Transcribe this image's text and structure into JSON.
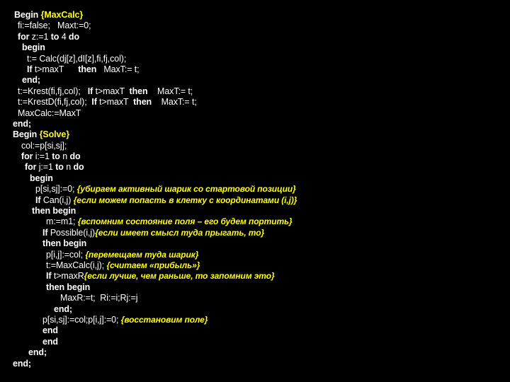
{
  "slide": {
    "background_color": "#000000",
    "code_color": "#FFFFFF",
    "comment_color": "#FFFF00",
    "lines": [
      {
        "indent": 20,
        "parts": [
          {
            "t": "Begin ",
            "s": "kw"
          },
          {
            "t": "{MaxCalc}",
            "s": "cmt-plain"
          }
        ]
      },
      {
        "indent": 25,
        "parts": [
          {
            "t": "fi:=false;   Maxt:=0;",
            "s": "txt"
          }
        ]
      },
      {
        "indent": 25,
        "parts": [
          {
            "t": "for ",
            "s": "kw"
          },
          {
            "t": "z:=1 ",
            "s": "txt"
          },
          {
            "t": "to ",
            "s": "kw"
          },
          {
            "t": "4 ",
            "s": "txt"
          },
          {
            "t": "do",
            "s": "kw"
          }
        ]
      },
      {
        "indent": 31,
        "parts": [
          {
            "t": "begin",
            "s": "kw"
          }
        ]
      },
      {
        "indent": 38,
        "parts": [
          {
            "t": "t:= Calc(dj[z],dI[z],fi,fj,col);",
            "s": "txt"
          }
        ]
      },
      {
        "indent": 38,
        "parts": [
          {
            "t": "If ",
            "s": "kw"
          },
          {
            "t": "t>maxT      ",
            "s": "txt"
          },
          {
            "t": "then ",
            "s": "kw"
          },
          {
            "t": "  MaxT:= t;",
            "s": "txt"
          }
        ]
      },
      {
        "indent": 31,
        "parts": [
          {
            "t": "end;",
            "s": "kw"
          }
        ]
      },
      {
        "indent": 25,
        "parts": [
          {
            "t": "t:=Krest(fi,fj,col);   ",
            "s": "txt"
          },
          {
            "t": "If ",
            "s": "kw"
          },
          {
            "t": "t>maxT  ",
            "s": "txt"
          },
          {
            "t": "then ",
            "s": "kw"
          },
          {
            "t": "   MaxT:= t;",
            "s": "txt"
          }
        ]
      },
      {
        "indent": 25,
        "parts": [
          {
            "t": "t:=KrestD(fi,fj,col);  ",
            "s": "txt"
          },
          {
            "t": "If ",
            "s": "kw"
          },
          {
            "t": "t>maxT  ",
            "s": "txt"
          },
          {
            "t": "then ",
            "s": "kw"
          },
          {
            "t": "   MaxT:= t;",
            "s": "txt"
          }
        ]
      },
      {
        "indent": 25,
        "parts": [
          {
            "t": "MaxCalc:=MaxT",
            "s": "txt"
          }
        ]
      },
      {
        "indent": 18,
        "parts": [
          {
            "t": "end;",
            "s": "kw"
          }
        ]
      },
      {
        "indent": 18,
        "parts": [
          {
            "t": "Begin ",
            "s": "kw"
          },
          {
            "t": "{Solve}",
            "s": "cmt-plain"
          }
        ]
      },
      {
        "indent": 30,
        "parts": [
          {
            "t": "col:=p[si,sj];",
            "s": "txt"
          }
        ]
      },
      {
        "indent": 30,
        "parts": [
          {
            "t": "for ",
            "s": "kw"
          },
          {
            "t": "i:=1 ",
            "s": "txt"
          },
          {
            "t": "to ",
            "s": "kw"
          },
          {
            "t": "n ",
            "s": "txt"
          },
          {
            "t": "do",
            "s": "kw"
          }
        ]
      },
      {
        "indent": 35,
        "parts": [
          {
            "t": "for ",
            "s": "kw"
          },
          {
            "t": "j:=1 ",
            "s": "txt"
          },
          {
            "t": "to ",
            "s": "kw"
          },
          {
            "t": "n ",
            "s": "txt"
          },
          {
            "t": "do",
            "s": "kw"
          }
        ]
      },
      {
        "indent": 42,
        "parts": [
          {
            "t": "begin",
            "s": "kw"
          }
        ]
      },
      {
        "indent": 50,
        "parts": [
          {
            "t": "p[si,sj]:=0; ",
            "s": "txt"
          },
          {
            "t": "{убираем активный шарик со стартовой позиции}",
            "s": "cmt"
          }
        ]
      },
      {
        "indent": 50,
        "parts": [
          {
            "t": "If ",
            "s": "kw"
          },
          {
            "t": "Can(i,j) ",
            "s": "txt"
          },
          {
            "t": "{если можем попасть в клетку с координатами (i,j)}",
            "s": "cmt"
          }
        ]
      },
      {
        "indent": 45,
        "parts": [
          {
            "t": "then begin",
            "s": "kw"
          }
        ]
      },
      {
        "indent": 65,
        "parts": [
          {
            "t": "m:=m1; ",
            "s": "txt"
          },
          {
            "t": "{вспомним состояние поля – его будем портить}",
            "s": "cmt"
          }
        ]
      },
      {
        "indent": 60,
        "parts": [
          {
            "t": "If ",
            "s": "kw"
          },
          {
            "t": "Possible(i,j)",
            "s": "txt"
          },
          {
            "t": "{если имеет смысл туда прыгать, то}",
            "s": "cmt"
          }
        ]
      },
      {
        "indent": 60,
        "parts": [
          {
            "t": "then begin",
            "s": "kw"
          }
        ]
      },
      {
        "indent": 65,
        "parts": [
          {
            "t": "p[i,j]:=col; ",
            "s": "txt"
          },
          {
            "t": "{перемещаем туда шарик}",
            "s": "cmt"
          }
        ]
      },
      {
        "indent": 65,
        "parts": [
          {
            "t": "t:=MaxCalc(i,j); ",
            "s": "txt"
          },
          {
            "t": "{считаем «прибыль»}",
            "s": "cmt"
          }
        ]
      },
      {
        "indent": 65,
        "parts": [
          {
            "t": "If ",
            "s": "kw"
          },
          {
            "t": "t>maxR",
            "s": "txt"
          },
          {
            "t": "{если лучше, чем раньше, то запомним это}",
            "s": "cmt"
          }
        ]
      },
      {
        "indent": 65,
        "parts": [
          {
            "t": "then begin",
            "s": "kw"
          }
        ]
      },
      {
        "indent": 85,
        "parts": [
          {
            "t": "MaxR:=t;  Ri:=i;Rj:=j",
            "s": "txt"
          }
        ]
      },
      {
        "indent": 76,
        "parts": [
          {
            "t": "end;",
            "s": "kw"
          }
        ]
      },
      {
        "indent": 60,
        "parts": [
          {
            "t": "p[si,sj]:=col;p[i,j]:=0; ",
            "s": "txt"
          },
          {
            "t": "{восстановим поле}",
            "s": "cmt"
          }
        ]
      },
      {
        "indent": 60,
        "parts": [
          {
            "t": "end",
            "s": "kw"
          }
        ]
      },
      {
        "indent": 60,
        "parts": [
          {
            "t": "end",
            "s": "kw"
          }
        ]
      },
      {
        "indent": 40,
        "parts": [
          {
            "t": "end;",
            "s": "kw"
          }
        ]
      },
      {
        "indent": 18,
        "parts": [
          {
            "t": "end;",
            "s": "kw"
          }
        ]
      }
    ]
  }
}
